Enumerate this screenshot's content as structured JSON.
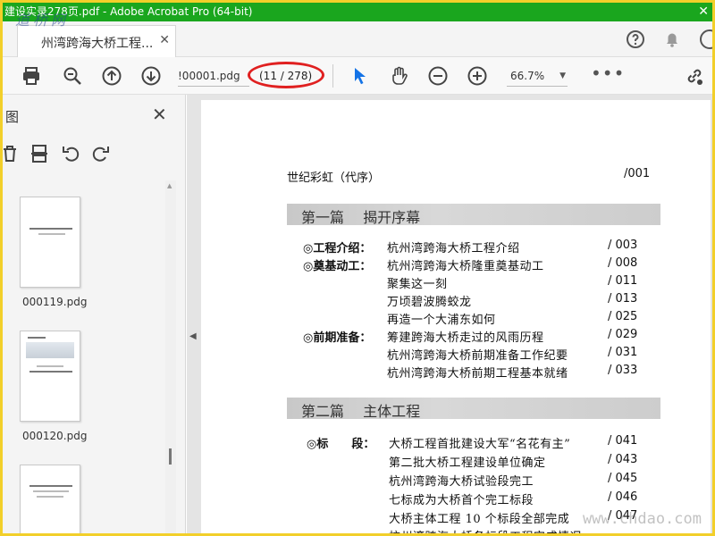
{
  "window": {
    "title": "建设实录278页.pdf - Adobe Acrobat Pro (64-bit)",
    "close_glyph": "✕",
    "watermark": "道桥网"
  },
  "tab": {
    "label": "州湾跨海大桥工程...",
    "close_glyph": "✕"
  },
  "toolbar": {
    "page_field": "!00001.pdg",
    "page_count": "(11 / 278)",
    "zoom": "66.7%",
    "more": "•••",
    "accent": "#1473e6",
    "highlight": "#e02020"
  },
  "sidebar": {
    "title": "图",
    "close_glyph": "✕",
    "thumbnails": [
      {
        "label": "000119.pdg"
      },
      {
        "label": "000120.pdg"
      }
    ]
  },
  "document": {
    "intro": {
      "title": "世纪彩虹（代序）",
      "page": "/001"
    },
    "sections": [
      {
        "title": "第一篇　 揭开序幕"
      },
      {
        "title": "第二篇　 主体工程"
      }
    ],
    "categories": [
      {
        "label": "◎工程介绍："
      },
      {
        "label": "◎奠基动工："
      },
      {
        "label": "◎前期准备："
      },
      {
        "label": "◎标　　段："
      }
    ],
    "entries": [
      {
        "title": "杭州湾跨海大桥工程介绍",
        "page": "/ 003"
      },
      {
        "title": "杭州湾跨海大桥隆重奠基动工",
        "page": "/ 008"
      },
      {
        "title": "聚集这一刻",
        "page": "/ 011"
      },
      {
        "title": "万顷碧波腾蛟龙",
        "page": "/ 013"
      },
      {
        "title": "再造一个大浦东如何",
        "page": "/ 025"
      },
      {
        "title": "筹建跨海大桥走过的风雨历程",
        "page": "/ 029"
      },
      {
        "title": "杭州湾跨海大桥前期准备工作纪要",
        "page": "/ 031"
      },
      {
        "title": "杭州湾跨海大桥前期工程基本就绪",
        "page": "/ 033"
      },
      {
        "title": "大桥工程首批建设大军“名花有主”",
        "page": "/ 041"
      },
      {
        "title": "第二批大桥工程建设单位确定",
        "page": "/ 043"
      },
      {
        "title": "杭州湾跨海大桥试验段完工",
        "page": "/ 045"
      },
      {
        "title": "七标成为大桥首个完工标段",
        "page": "/ 046"
      },
      {
        "title": "大桥主体工程 10 个标段全部完成",
        "page": "/ 047"
      },
      {
        "title": "杭州湾跨海大桥各标段工程完成情况",
        "page": ""
      }
    ],
    "watermark": "www.chdao.com"
  }
}
